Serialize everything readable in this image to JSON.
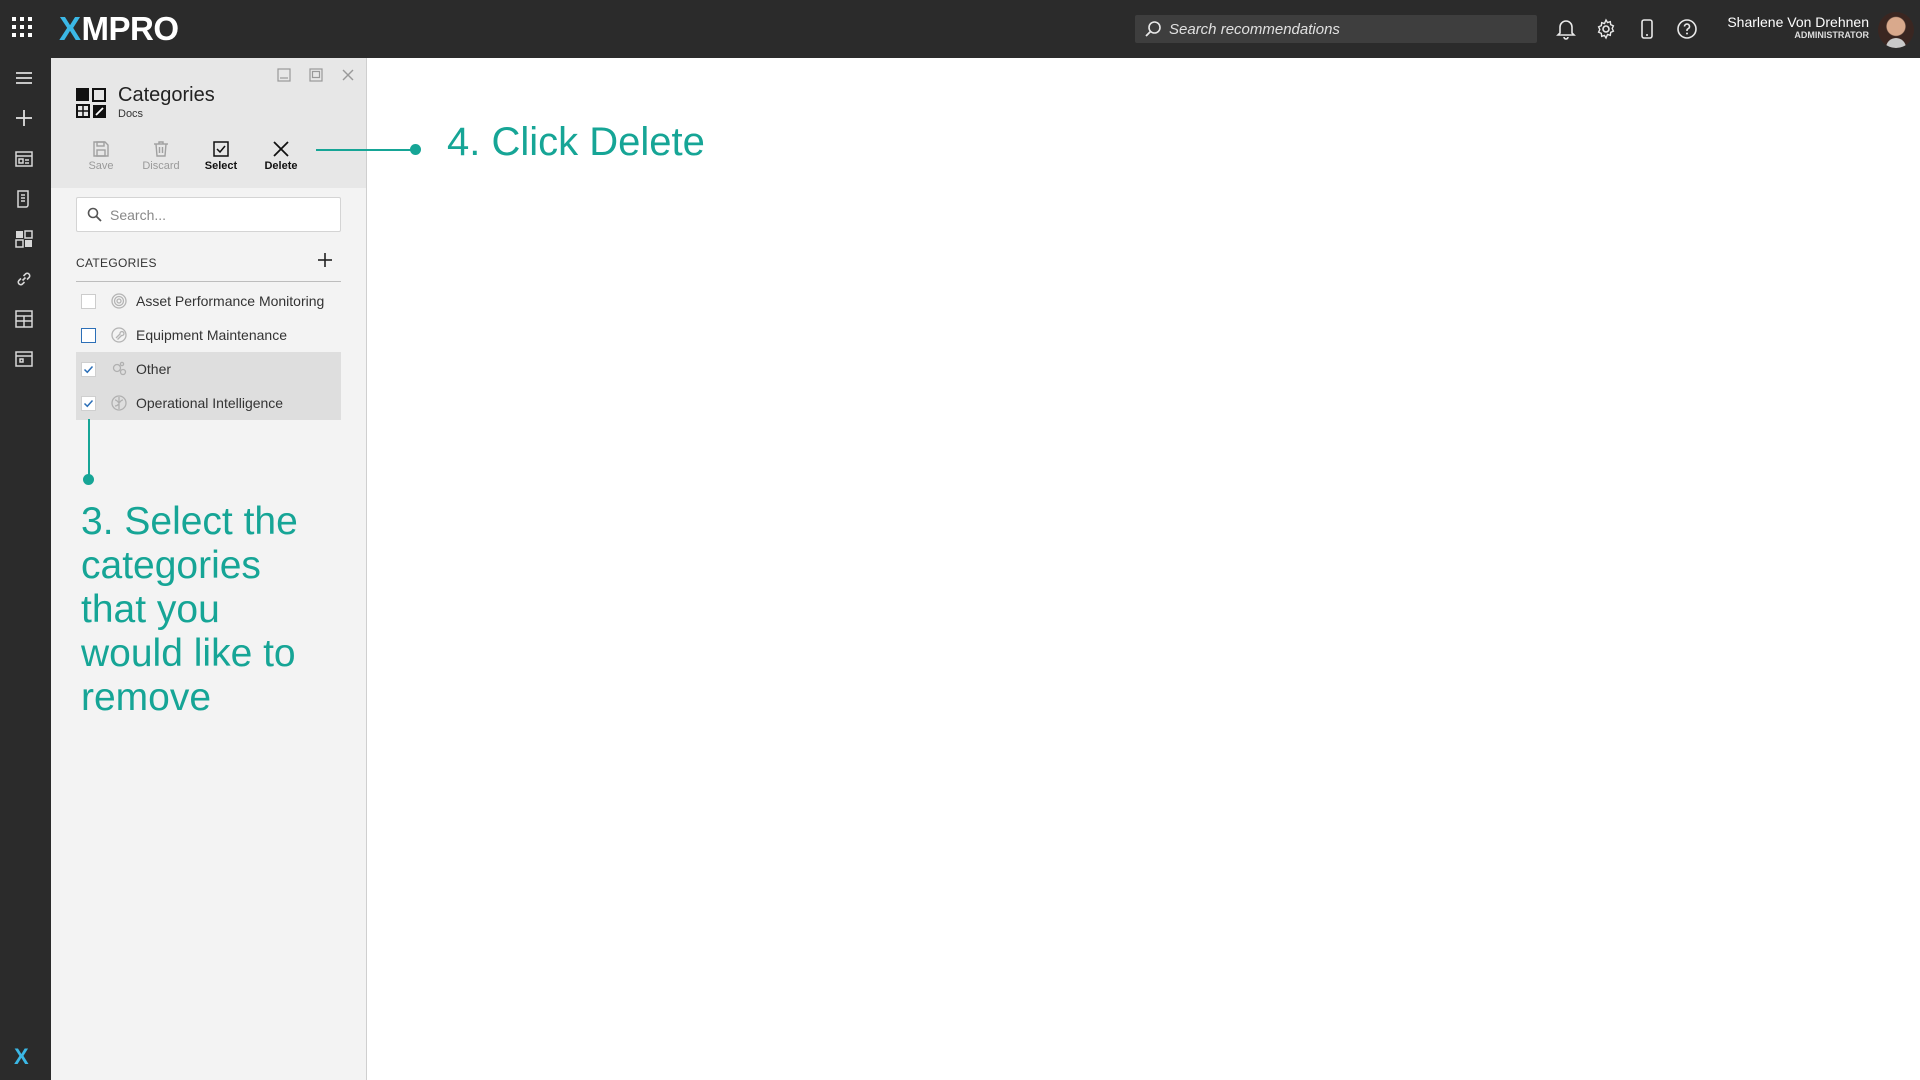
{
  "app": {
    "logo_x": "X",
    "logo_rest": "MPRO"
  },
  "topbar": {
    "search_placeholder": "Search recommendations",
    "user_name": "Sharlene Von Drehnen",
    "user_role": "ADMINISTRATOR"
  },
  "panel": {
    "title": "Categories",
    "subtitle": "Docs",
    "toolbar": {
      "save": "Save",
      "discard": "Discard",
      "select": "Select",
      "delete": "Delete"
    },
    "search_placeholder": "Search...",
    "categories_header": "CATEGORIES",
    "items": [
      {
        "label": "Asset Performance Monitoring",
        "checked": false
      },
      {
        "label": "Equipment Maintenance",
        "checked": false
      },
      {
        "label": "Other",
        "checked": true
      },
      {
        "label": "Operational Intelligence",
        "checked": true
      }
    ]
  },
  "annotations": {
    "step4": "4. Click Delete",
    "step3": "3. Select the categories that you would like to remove"
  },
  "colors": {
    "accent": "#16a596",
    "topbar": "#2b2b2b",
    "brand": "#3bb8e6"
  }
}
